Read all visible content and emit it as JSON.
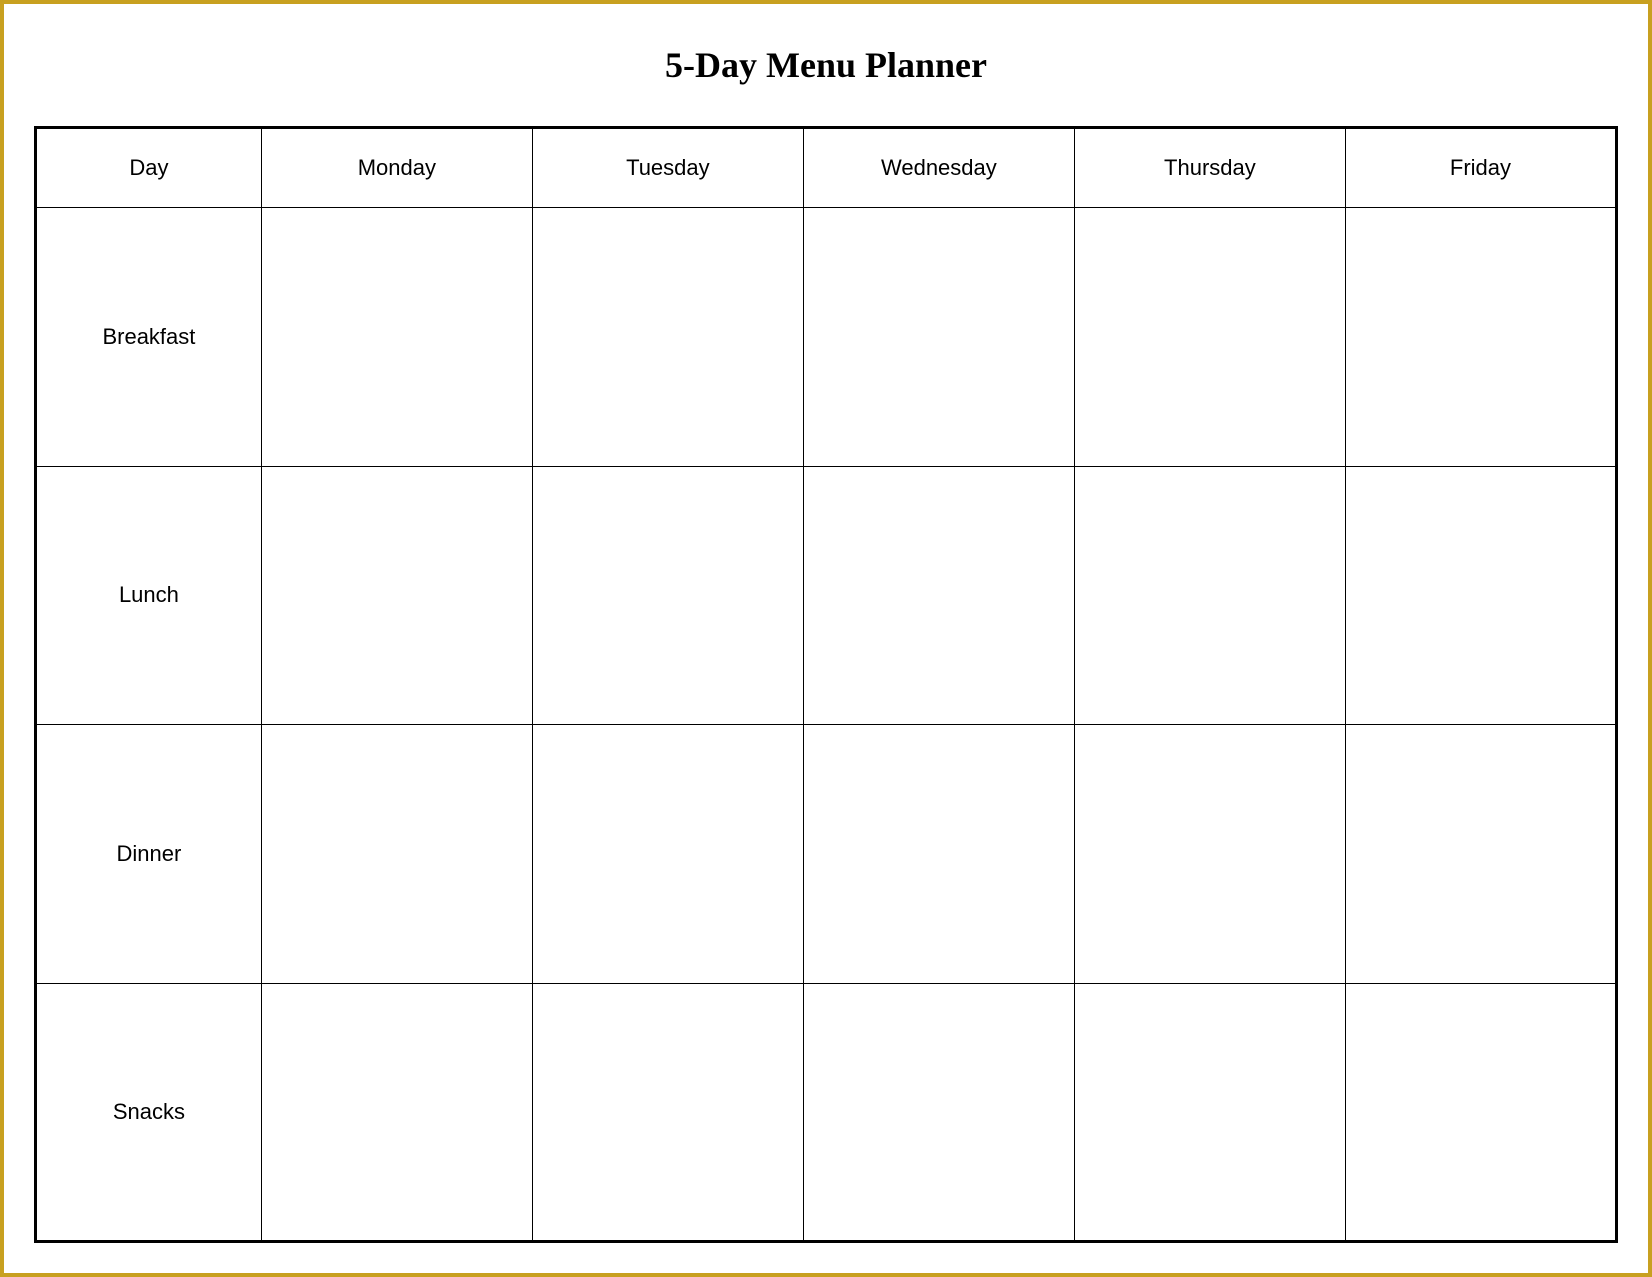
{
  "title": "5-Day Menu Planner",
  "columns": {
    "day": "Day",
    "monday": "Monday",
    "tuesday": "Tuesday",
    "wednesday": "Wednesday",
    "thursday": "Thursday",
    "friday": "Friday"
  },
  "meals": [
    {
      "label": "Breakfast"
    },
    {
      "label": "Lunch"
    },
    {
      "label": "Dinner"
    },
    {
      "label": "Snacks"
    }
  ]
}
